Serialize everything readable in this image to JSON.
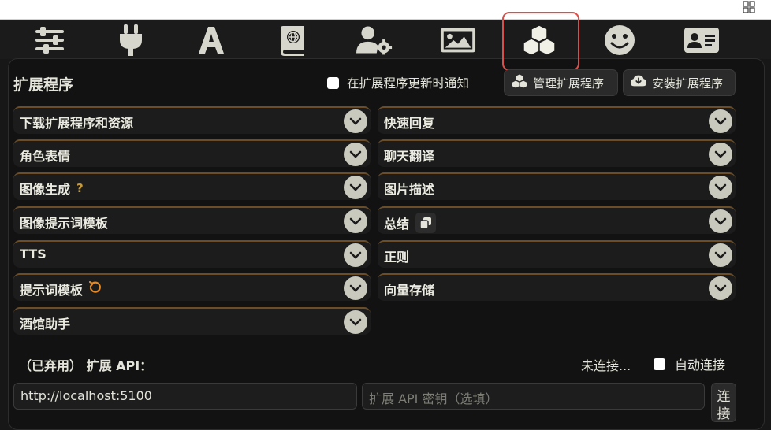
{
  "topbar": {
    "icons": [
      "sliders-icon",
      "plug-icon",
      "font-icon",
      "book-globe-icon",
      "user-gear-icon",
      "image-icon",
      "cubes-icon",
      "smiley-icon",
      "id-card-icon"
    ],
    "highlight_color": "#d9504a"
  },
  "extensions": {
    "title": "扩展程序",
    "notify_label": "在扩展程序更新时通知",
    "manage_label": "管理扩展程序",
    "install_label": "安装扩展程序",
    "left_items": [
      {
        "label": "下载扩展程序和资源"
      },
      {
        "label": "角色表情"
      },
      {
        "label": "图像生成",
        "suffix": "?"
      },
      {
        "label": "图像提示词模板"
      },
      {
        "label": "TTS"
      },
      {
        "label": "提示词模板"
      },
      {
        "label": "酒馆助手"
      }
    ],
    "right_items": [
      {
        "label": "快速回复"
      },
      {
        "label": "聊天翻译"
      },
      {
        "label": "图片描述"
      },
      {
        "label": "总结"
      },
      {
        "label": "正则"
      },
      {
        "label": "向量存储"
      }
    ],
    "api": {
      "label": "（已弃用） 扩展 API：",
      "status": "未连接...",
      "auto_connect_label": "自动连接",
      "url_value": "http://localhost:5100",
      "key_placeholder": "扩展 API 密钥（选填）",
      "connect_label": "连接"
    }
  }
}
